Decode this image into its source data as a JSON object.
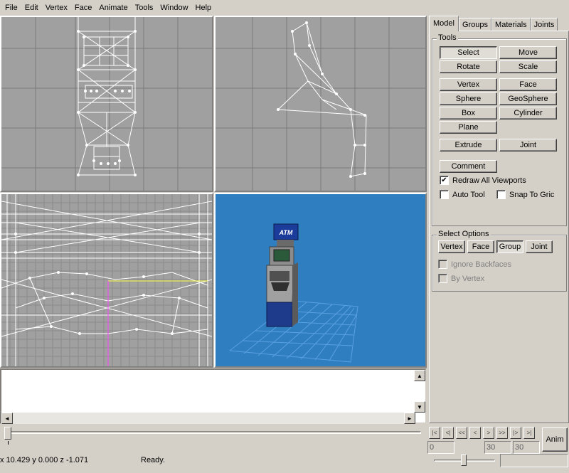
{
  "menu": [
    "File",
    "Edit",
    "Vertex",
    "Face",
    "Animate",
    "Tools",
    "Window",
    "Help"
  ],
  "tabs": [
    "Model",
    "Groups",
    "Materials",
    "Joints"
  ],
  "tools": {
    "title": "Tools",
    "select": "Select",
    "move": "Move",
    "rotate": "Rotate",
    "scale": "Scale",
    "vertex": "Vertex",
    "face": "Face",
    "sphere": "Sphere",
    "geosphere": "GeoSphere",
    "box": "Box",
    "cylinder": "Cylinder",
    "plane": "Plane",
    "extrude": "Extrude",
    "joint": "Joint",
    "comment": "Comment",
    "redraw": "Redraw All Viewports",
    "auto_tool": "Auto Tool",
    "snap": "Snap To Gric"
  },
  "select_options": {
    "title": "Select Options",
    "vertex": "Vertex",
    "face": "Face",
    "group": "Group",
    "joint": "Joint",
    "ignore_backfaces": "Ignore Backfaces",
    "by_vertex": "By Vertex"
  },
  "timeline": {
    "frame_start": "0",
    "frame_a": "30",
    "frame_b": "30",
    "anim_label": "Anim",
    "controls": [
      "|<",
      "<|",
      "<<",
      "<",
      ">",
      ">>",
      "|>",
      ">|"
    ]
  },
  "status": {
    "coords": "x 10.429 y 0.000 z -1.071",
    "message": "Ready."
  },
  "atm_sign": "ATM",
  "colors": {
    "viewport_bg": "#a0a0a0",
    "view3d_bg": "#2f7ec0",
    "wire": "#ffffff"
  }
}
